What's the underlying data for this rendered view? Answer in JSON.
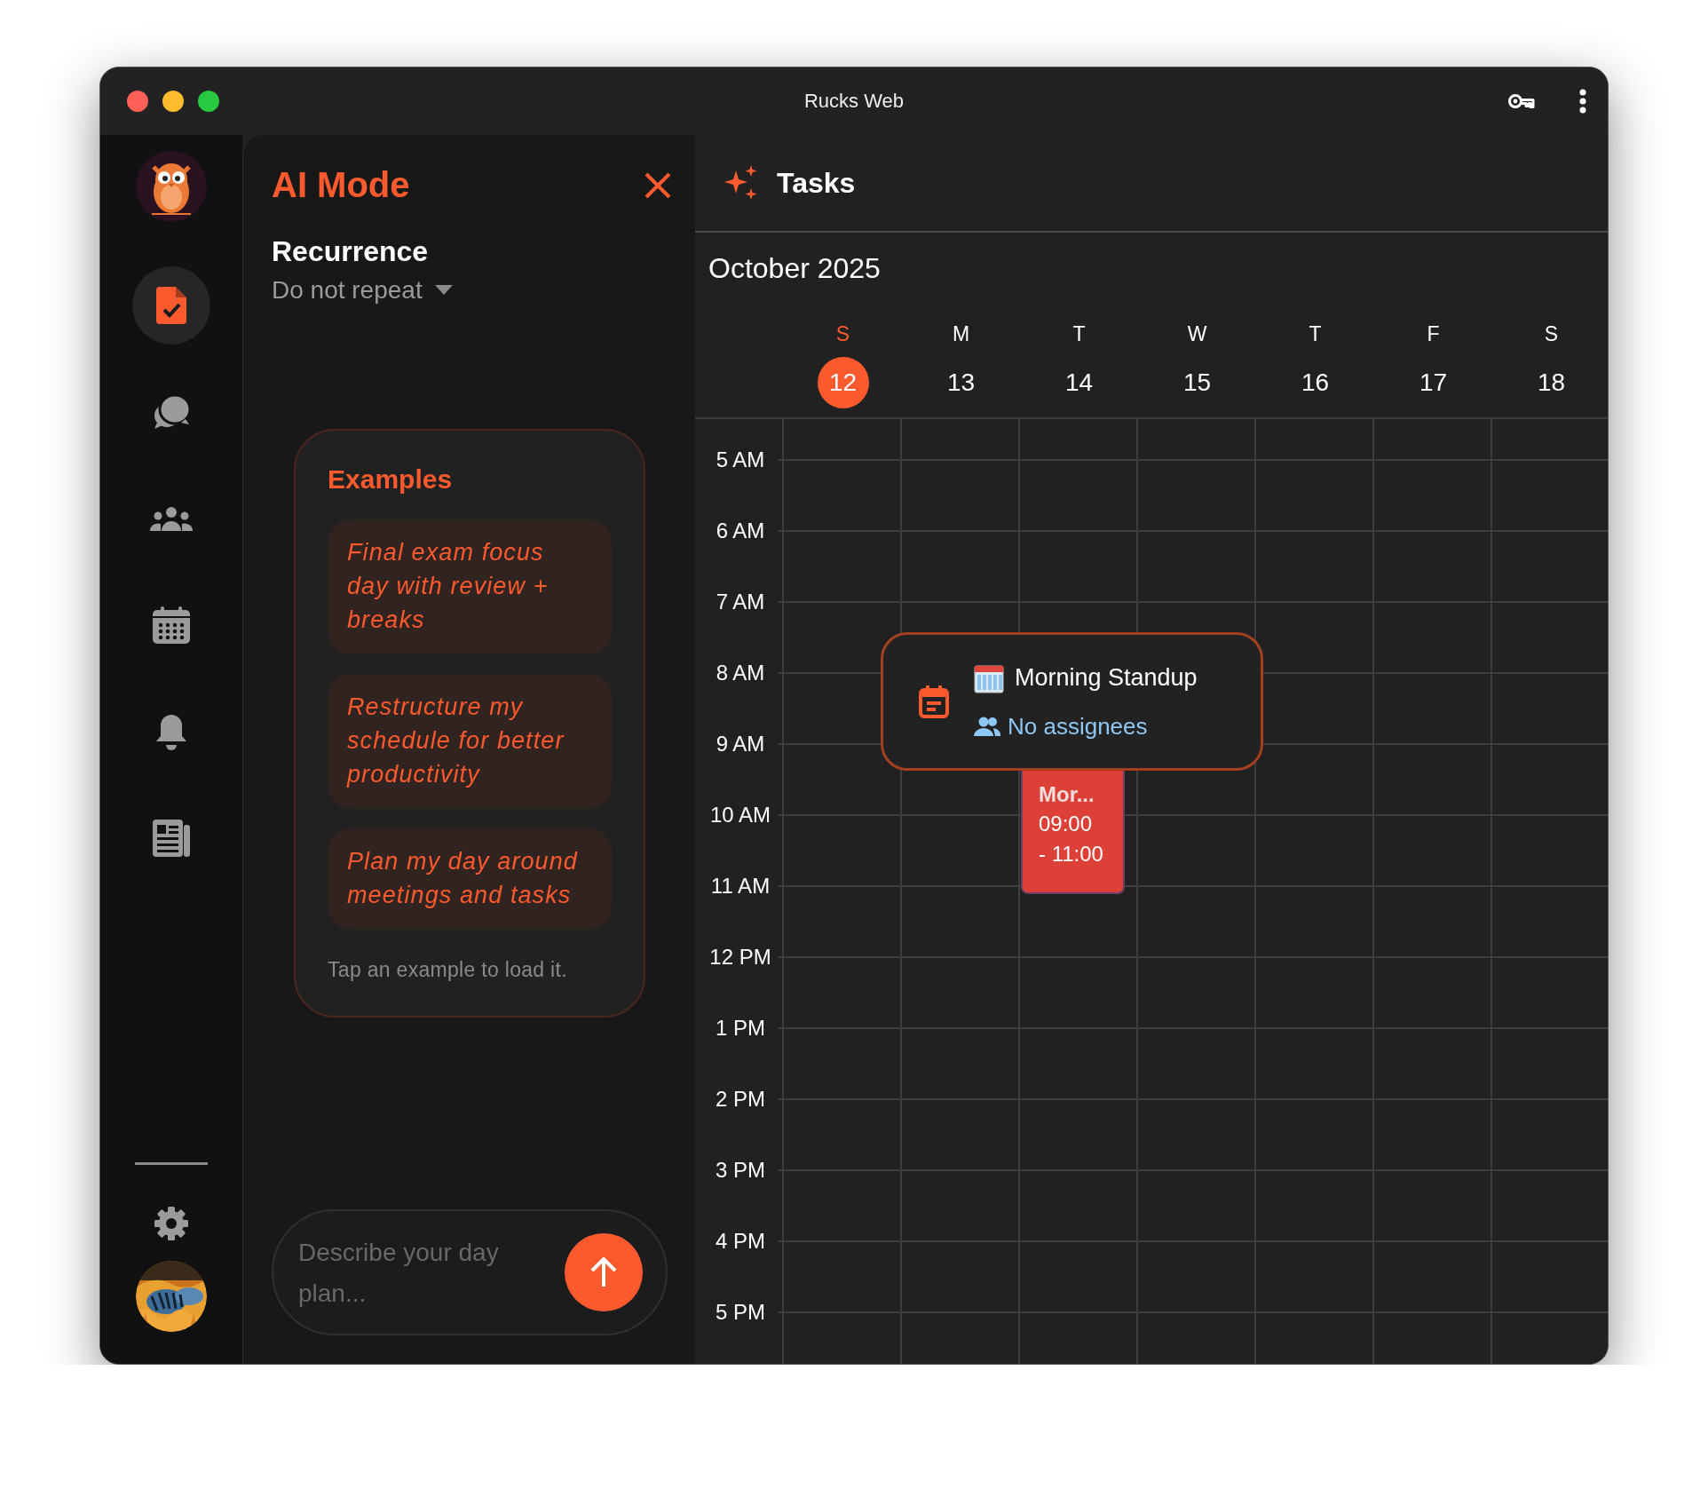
{
  "window": {
    "title": "Rucks Web"
  },
  "sidebar": {
    "items": [
      {
        "kind": "tasks",
        "selected": true
      },
      {
        "kind": "chat",
        "selected": false
      },
      {
        "kind": "team",
        "selected": false
      },
      {
        "kind": "calendar",
        "selected": false
      },
      {
        "kind": "bell",
        "selected": false
      },
      {
        "kind": "news",
        "selected": false
      }
    ]
  },
  "ai_panel": {
    "title": "AI Mode",
    "recurrence": {
      "label": "Recurrence",
      "value": "Do not repeat"
    },
    "examples": {
      "title": "Examples",
      "items": [
        "Final exam focus day with review + breaks",
        "Restructure my schedule for better productivity",
        "Plan my day around meetings and tasks"
      ],
      "hint": "Tap an example to load it."
    },
    "input": {
      "placeholder": "Describe your day plan..."
    }
  },
  "calendar": {
    "title": "Tasks",
    "month": "October 2025",
    "days": [
      {
        "letter": "S",
        "date": "12",
        "selected": true
      },
      {
        "letter": "M",
        "date": "13",
        "selected": false
      },
      {
        "letter": "T",
        "date": "14",
        "selected": false
      },
      {
        "letter": "W",
        "date": "15",
        "selected": false
      },
      {
        "letter": "T",
        "date": "16",
        "selected": false
      },
      {
        "letter": "F",
        "date": "17",
        "selected": false
      },
      {
        "letter": "S",
        "date": "18",
        "selected": false
      }
    ],
    "hours": [
      "5 AM",
      "6 AM",
      "7 AM",
      "8 AM",
      "9 AM",
      "10 AM",
      "11 AM",
      "12 PM",
      "1 PM",
      "2 PM",
      "3 PM",
      "4 PM",
      "5 PM"
    ],
    "event": {
      "title": "Mor...",
      "time_lines": [
        "09:00",
        "- 11:00"
      ]
    },
    "popup": {
      "title": "Morning Standup",
      "assignees": "No assignees"
    }
  }
}
